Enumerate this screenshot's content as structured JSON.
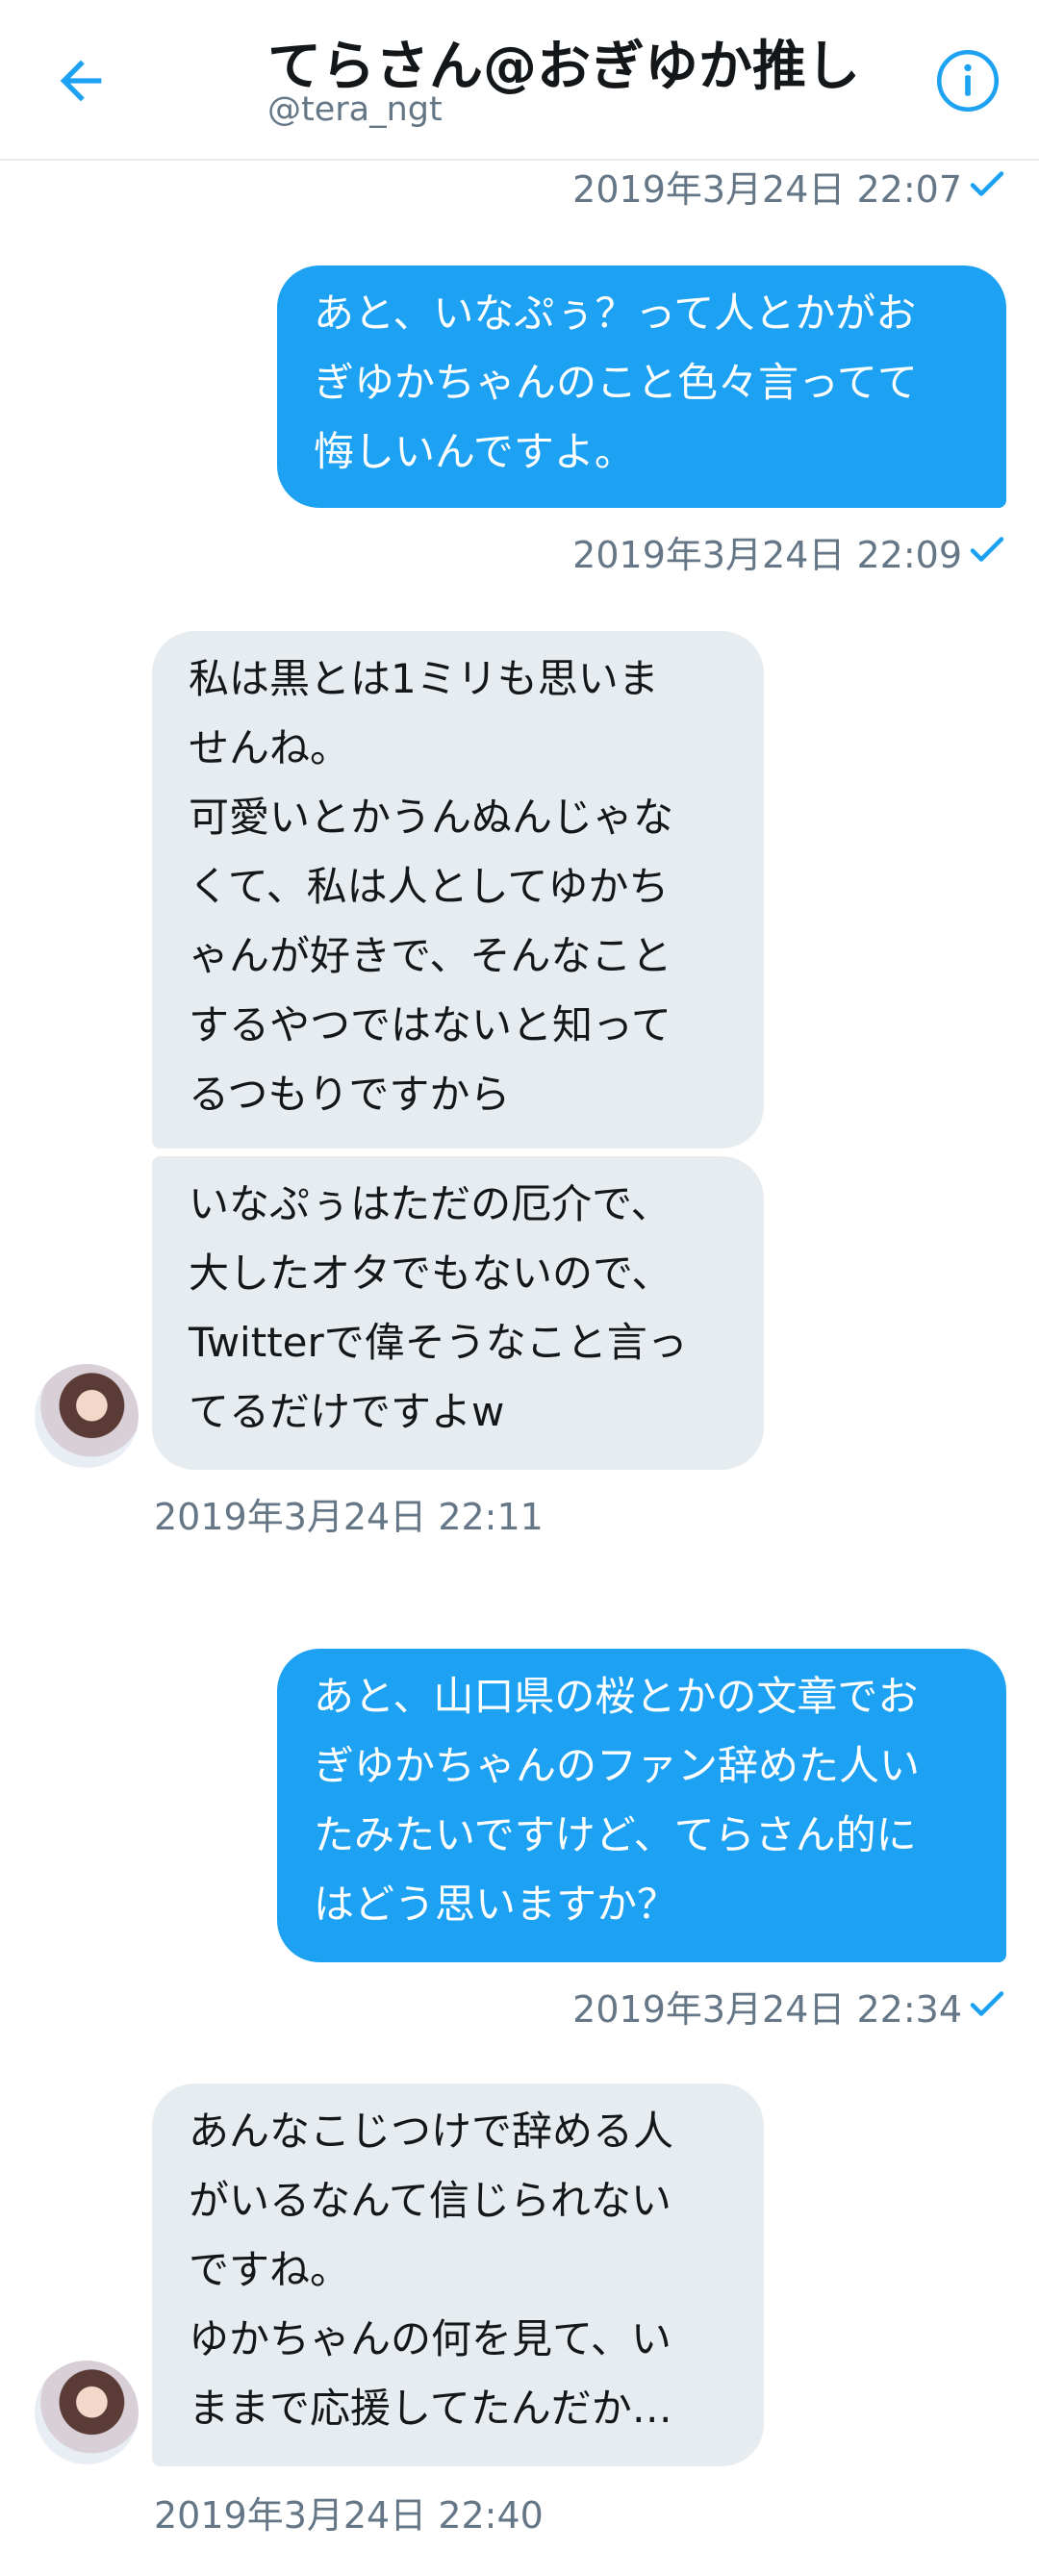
{
  "header": {
    "title": "てらさん@おぎゆか推し",
    "handle": "@tera_ngt",
    "back_icon": "arrow-left-icon",
    "info_icon": "info-icon",
    "accent": "#1da1f2"
  },
  "messages": [
    {
      "type": "timestamp_sent",
      "text": "2019年3月24日 22:07"
    },
    {
      "type": "sent",
      "text": "あと、いなぷぅ？って人とかがお\nぎゆかちゃんのこと色々言ってて\n悔しいんですよ。"
    },
    {
      "type": "timestamp_sent",
      "text": "2019年3月24日 22:09"
    },
    {
      "type": "received",
      "text": "私は黒とは1ミリも思いま\nせんね。\n可愛いとかうんぬんじゃな\nくて、私は人としてゆかち\nゃんが好きで、そんなこと\nするやつではないと知って\nるつもりですから"
    },
    {
      "type": "received",
      "text": "いなぷぅはただの厄介で、\n大したオタでもないので、\nTwitterで偉そうなこと言っ\nてるだけですよw"
    },
    {
      "type": "timestamp_received",
      "text": "2019年3月24日 22:11"
    },
    {
      "type": "sent",
      "text": "あと、山口県の桜とかの文章でお\nぎゆかちゃんのファン辞めた人い\nたみたいですけど、てらさん的に\nはどう思いますか？"
    },
    {
      "type": "timestamp_sent",
      "text": "2019年3月24日 22:34"
    },
    {
      "type": "received",
      "text": "あんなこじつけで辞める人\nがいるなんて信じられない\nですね。\nゆかちゃんの何を見て、い\nままで応援してたんだか…"
    },
    {
      "type": "timestamp_received",
      "text": "2019年3月24日 22:40"
    }
  ],
  "colors": {
    "sent_bubble": "#1da1f2",
    "received_bubble": "#e6ecf0",
    "timestamp": "#657786",
    "read_check": "#1da1f2"
  }
}
